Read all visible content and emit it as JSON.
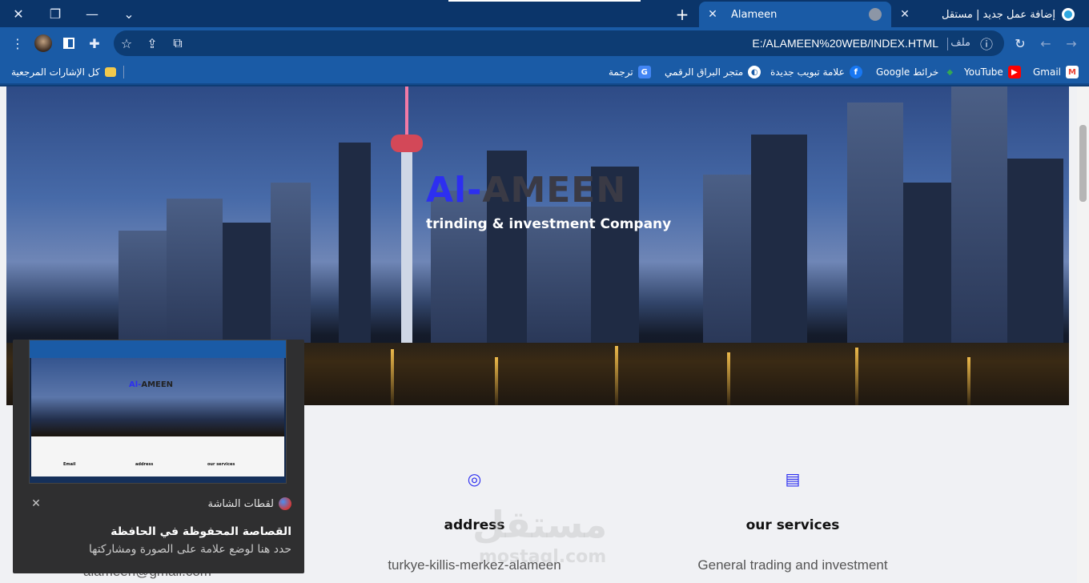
{
  "window": {
    "close_glyph": "✕",
    "restore_glyph": "❐",
    "minimize_glyph": "—",
    "tabsearch_glyph": "⌄"
  },
  "tabs": [
    {
      "title": "Alameen",
      "active": true
    },
    {
      "title": "إضافة عمل جديد | مستقل",
      "active": false
    }
  ],
  "toolbar": {
    "url": "E:/ALAMEEN%20WEB/INDEX.HTML",
    "file_label": "ملف",
    "more_glyph": "⋮",
    "star_glyph": "☆"
  },
  "bookmarks": {
    "all_label": "كل الإشارات المرجعية",
    "items": [
      {
        "label": "Gmail",
        "icon": "gmail-icon",
        "color": "#ea4335"
      },
      {
        "label": "YouTube",
        "icon": "youtube-icon",
        "color": "#ff0000"
      },
      {
        "label": "Google خرائط",
        "icon": "maps-icon",
        "color": "#34a853"
      },
      {
        "label": "علامة تبويب جديدة",
        "icon": "facebook-icon",
        "color": "#1877f2"
      },
      {
        "label": "متجر البراق الرقمي",
        "icon": "globe-icon",
        "color": "#ffffff"
      },
      {
        "label": "ترجمة",
        "icon": "translate-icon",
        "color": "#4285f4"
      }
    ]
  },
  "hero": {
    "title_part1": "Al-",
    "title_part2": "AMEEN",
    "subtitle": "trinding & investment Company"
  },
  "info": [
    {
      "icon": "location-pin-icon",
      "heading": "address",
      "text": "turkye-killis-merkez-alameen"
    },
    {
      "icon": "briefcase-icon",
      "heading": "our services",
      "text": "General trading and investment"
    }
  ],
  "email_partial": "alameen@gmail.com",
  "watermark": {
    "main": "مستقل",
    "sub": "mostaql.com"
  },
  "notification": {
    "app_name": "لقطات الشاشة",
    "title": "القصاصة المحفوظة في الحافظة",
    "body": "حدد هنا لوضع علامة على الصورة ومشاركتها",
    "thumb_title1": "Al-",
    "thumb_title2": "AMEEN",
    "thumb_labels": [
      "Email",
      "address",
      "our services"
    ]
  },
  "colors": {
    "accent": "#2d2ff0",
    "chrome": "#1a5ba6"
  }
}
